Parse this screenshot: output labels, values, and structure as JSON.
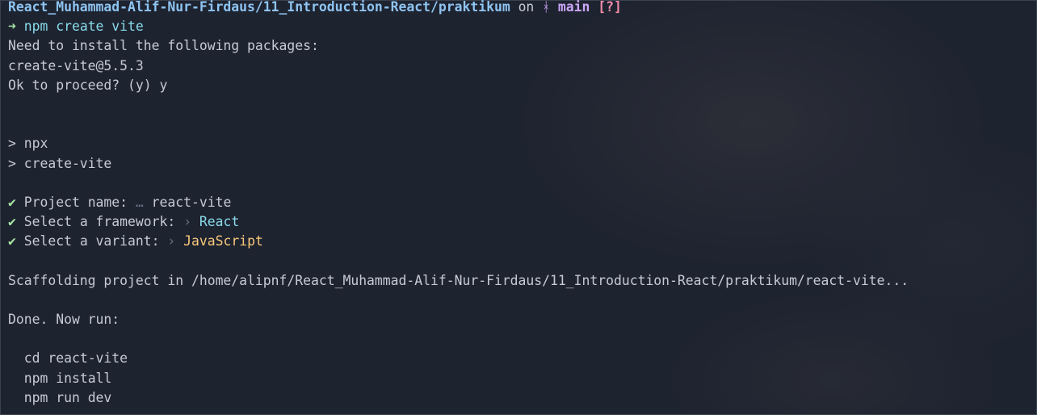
{
  "prompt": {
    "path": "React_Muhammad-Alif-Nur-Firdaus/11_Introduction-React/praktikum",
    "on": "on",
    "branch_icon": "ᚼ",
    "branch": "main",
    "status": "[?]"
  },
  "command": {
    "arrow": "➜",
    "text": "npm create vite"
  },
  "install": {
    "line1": "Need to install the following packages:",
    "line2": "create-vite@5.5.3",
    "line3": "Ok to proceed? (y) y"
  },
  "npx": {
    "line1": "> npx",
    "line2": "> create-vite"
  },
  "answers": [
    {
      "check": "✔",
      "label": "Project name:",
      "sep": "…",
      "value": "react-vite"
    },
    {
      "check": "✔",
      "label": "Select a framework:",
      "sep": "›",
      "value": "React"
    },
    {
      "check": "✔",
      "label": "Select a variant:",
      "sep": "›",
      "value": "JavaScript"
    }
  ],
  "scaffold": "Scaffolding project in /home/alipnf/React_Muhammad-Alif-Nur-Firdaus/11_Introduction-React/praktikum/react-vite...",
  "done": "Done. Now run:",
  "next_steps": [
    "cd react-vite",
    "npm install",
    "npm run dev"
  ]
}
